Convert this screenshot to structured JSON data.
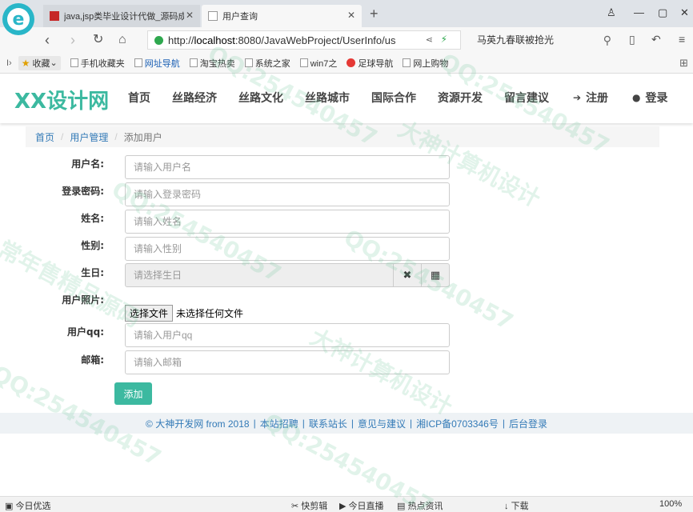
{
  "browser": {
    "tabs": [
      {
        "label": "java,jsp类毕业设计代做_源码成…",
        "active": false
      },
      {
        "label": "用户查询",
        "active": true
      }
    ],
    "url_prefix": "http://",
    "url_host": "localhost",
    "url_rest": ":8080/JavaWebProject/UserInfo/us",
    "search_text": "马英九春联被抢光",
    "bookmarks": [
      "收藏",
      "手机收藏夹",
      "网址导航",
      "淘宝热卖",
      "系统之家",
      "win7之",
      "足球导航",
      "网上购物"
    ],
    "status_left": "今日优选",
    "status_items": [
      "快剪辑",
      "今日直播",
      "热点资讯",
      "下载"
    ],
    "zoom": "100%"
  },
  "site": {
    "logo": "XX设计网",
    "nav": [
      "首页",
      "丝路经济",
      "丝路文化",
      "丝路城市",
      "国际合作",
      "资源开发",
      "留言建议"
    ],
    "register": "注册",
    "login": "登录"
  },
  "breadcrumb": {
    "home": "首页",
    "section": "用户管理",
    "current": "添加用户"
  },
  "form": {
    "username": {
      "label": "用户名:",
      "placeholder": "请输入用户名"
    },
    "password": {
      "label": "登录密码:",
      "placeholder": "请输入登录密码"
    },
    "name": {
      "label": "姓名:",
      "placeholder": "请输入姓名"
    },
    "gender": {
      "label": "性别:",
      "placeholder": "请输入性别"
    },
    "birthday": {
      "label": "生日:",
      "placeholder": "请选择生日"
    },
    "photo": {
      "label": "用户照片:",
      "button": "选择文件",
      "status": "未选择任何文件"
    },
    "qq": {
      "label": "用户qq:",
      "placeholder": "请输入用户qq"
    },
    "email": {
      "label": "邮箱:",
      "placeholder": "请输入邮箱"
    },
    "submit": "添加"
  },
  "footer": {
    "copyright": "© 大神开发网 from 2018",
    "links": [
      "本站招聘",
      "联系站长",
      "意见与建议",
      "湘ICP备0703346号",
      "后台登录"
    ]
  },
  "watermarks": [
    "QQ:254540457",
    "大神计算机设计",
    "常年售精品源码"
  ],
  "colors": {
    "accent": "#3cb9a0",
    "link": "#337ab7"
  }
}
